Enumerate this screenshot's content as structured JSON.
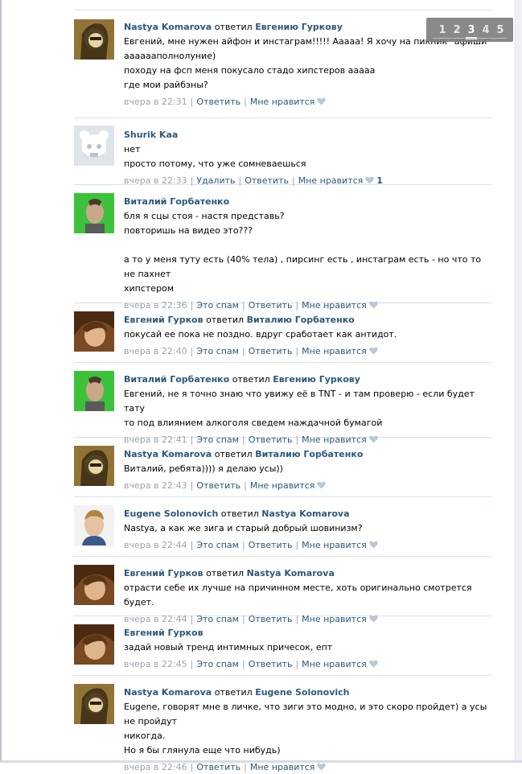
{
  "pager": {
    "pages": [
      "1",
      "2",
      "3",
      "4",
      "5"
    ],
    "current": "3"
  },
  "labels": {
    "replied": "ответил",
    "reply": "Ответить",
    "like": "Мне нравится",
    "spam": "Это спам",
    "delete": "Удалить"
  },
  "comments": [
    {
      "author": "Nastya Komarova",
      "reply_to": "Евгению Гуркову",
      "lines": [
        "Евгений, мне нужен айфон и инстаграм!!!!! Ааааа! Я хочу на пикник \"афиши\"",
        "ааааааполнолуние)",
        "походу на фсп меня покусало стадо хипстеров ааааа",
        "где мои райбэны?"
      ],
      "time": "вчера в 22:31",
      "actions": [
        "reply"
      ],
      "likes": ""
    },
    {
      "author": "Shurik Kaa",
      "reply_to": "",
      "lines": [
        "нет",
        "просто потому, что уже сомневаешься"
      ],
      "time": "вчера в 22:33",
      "actions": [
        "delete",
        "reply"
      ],
      "likes": "1"
    },
    {
      "author": "Виталий Горбатенко",
      "reply_to": "",
      "lines": [
        "бля я сцы стоя - настя представь?",
        "повторишь на видео это???",
        "",
        "а то у меня туту есть (40% тела) , пирсинг есть , инстаграм есть - но что то не пахнет",
        "хипстером"
      ],
      "time": "вчера в 22:36",
      "actions": [
        "spam",
        "reply"
      ],
      "likes": ""
    },
    {
      "author": "Евгений Гурков",
      "reply_to": "Виталию Горбатенко",
      "lines": [
        "покусай ее пока не поздно. вдруг сработает как антидот."
      ],
      "time": "вчера в 22:40",
      "actions": [
        "spam",
        "reply"
      ],
      "likes": ""
    },
    {
      "author": "Виталий Горбатенко",
      "reply_to": "Евгению Гуркову",
      "lines": [
        "Евгений, не я точно знаю что увижу её в TNT - и там проверю - если будет тату",
        "то под влиянием алкоголя сведем наждачной бумагой"
      ],
      "time": "вчера в 22:41",
      "actions": [
        "spam",
        "reply"
      ],
      "likes": ""
    },
    {
      "author": "Nastya Komarova",
      "reply_to": "Виталию Горбатенко",
      "lines": [
        "Виталий, ребята)))) я делаю усы))"
      ],
      "time": "вчера в 22:43",
      "actions": [
        "reply"
      ],
      "likes": ""
    },
    {
      "author": "Eugene Solonovich",
      "reply_to": "Nastya Komarova",
      "lines": [
        "Nastya, а как же зига и старый добрый шовинизм?"
      ],
      "time": "вчера в 22:44",
      "actions": [
        "spam",
        "reply"
      ],
      "likes": ""
    },
    {
      "author": "Евгений Гурков",
      "reply_to": "Nastya Komarova",
      "lines": [
        "отрасти себе их лучше на причинном месте, хоть оригинально смотрется будет."
      ],
      "time": "вчера в 22:44",
      "actions": [
        "spam",
        "reply"
      ],
      "likes": ""
    },
    {
      "author": "Евгений Гурков",
      "reply_to": "",
      "lines": [
        "задай новый тренд интимных причесок, епт"
      ],
      "time": "вчера в 22:45",
      "actions": [
        "spam",
        "reply"
      ],
      "likes": ""
    },
    {
      "author": "Nastya Komarova",
      "reply_to": "Eugene Solonovich",
      "lines": [
        "Eugene, говорят мне в личке, что зиги это модно, и это скоро пройдет) а усы не пройдут",
        "никогда.",
        "Но я бы глянула еще что нибудь)"
      ],
      "time": "вчера в 22:46",
      "actions": [
        "reply"
      ],
      "likes": ""
    }
  ]
}
